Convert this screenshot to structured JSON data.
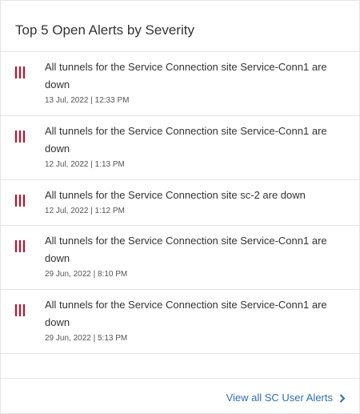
{
  "card": {
    "title": "Top 5 Open Alerts by Severity",
    "severity_icon": "critical-severity-bars-icon",
    "severity_color": "#d0021b",
    "accent_color": "#2f6eb5"
  },
  "alerts": [
    {
      "message": "All tunnels for the Service Connection site Service-Conn1 are down",
      "timestamp": "13 Jul, 2022 | 12:33 PM"
    },
    {
      "message": "All tunnels for the Service Connection site Service-Conn1 are down",
      "timestamp": "12 Jul, 2022 | 1:13 PM"
    },
    {
      "message": "All tunnels for the Service Connection site sc-2 are down",
      "timestamp": "12 Jul, 2022 | 1:12 PM"
    },
    {
      "message": "All tunnels for the Service Connection site Service-Conn1 are down",
      "timestamp": "29 Jun, 2022 | 8:10 PM"
    },
    {
      "message": "All tunnels for the Service Connection site Service-Conn1 are down",
      "timestamp": "29 Jun, 2022 | 5:13 PM"
    }
  ],
  "footer": {
    "link_label": "View all SC User Alerts",
    "link_icon": "chevron-right-icon"
  }
}
